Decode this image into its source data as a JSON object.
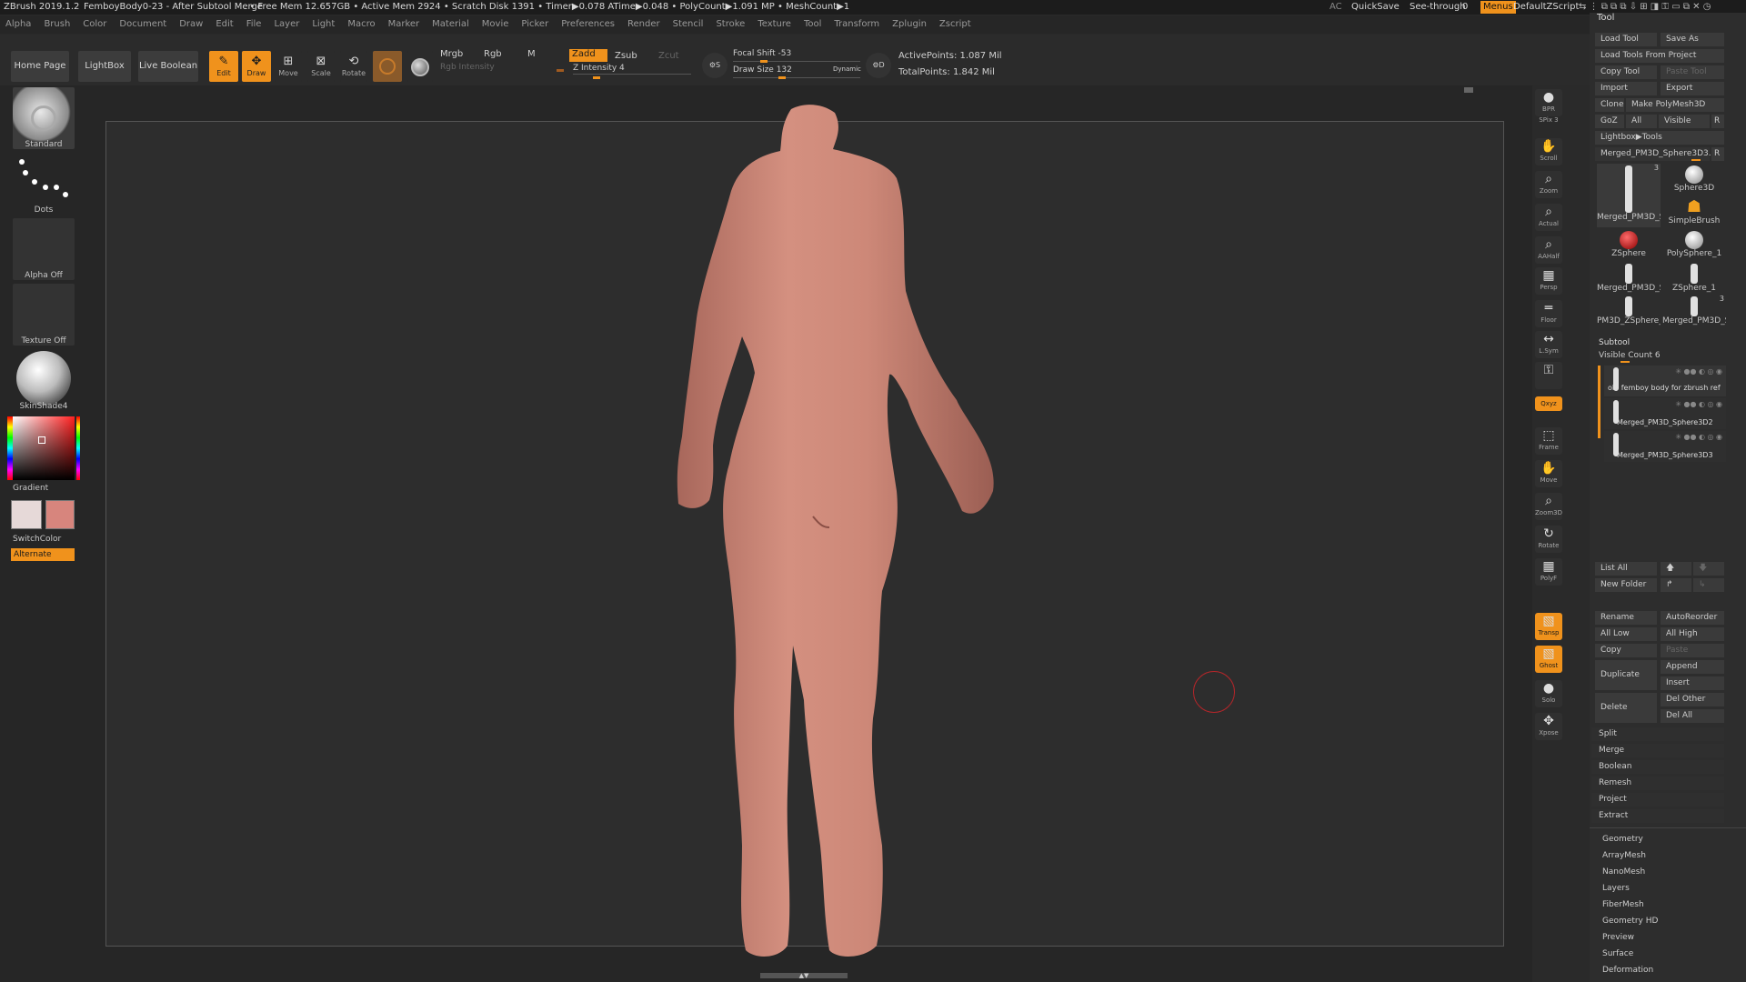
{
  "titlebar": {
    "app": "ZBrush 2019.1.2",
    "doc": "FemboyBody0-23 - After Subtool Merge",
    "stats": ". • Free Mem 12.657GB • Active Mem 2924 • Scratch Disk 1391 • Timer▶0.078 ATime▶0.048 • PolyCount▶1.091 MP • MeshCount▶1",
    "ac": "AC",
    "quicksave": "QuickSave",
    "seethrough": "See-through",
    "seethrough_value": "0",
    "menus": "Menus",
    "script": "DefaultZScript"
  },
  "menus": [
    "Alpha",
    "Brush",
    "Color",
    "Document",
    "Draw",
    "Edit",
    "File",
    "Layer",
    "Light",
    "Macro",
    "Marker",
    "Material",
    "Movie",
    "Picker",
    "Preferences",
    "Render",
    "Stencil",
    "Stroke",
    "Texture",
    "Tool",
    "Transform",
    "Zplugin",
    "Zscript"
  ],
  "shelf": {
    "home": "Home Page",
    "lightbox": "LightBox",
    "liveboolean": "Live Boolean",
    "edit": "Edit",
    "draw": "Draw",
    "move": "Move",
    "scale": "Scale",
    "rotate": "Rotate",
    "mrgb": "Mrgb",
    "rgb": "Rgb",
    "m": "M",
    "rgb_intensity": "Rgb Intensity",
    "zadd": "Zadd",
    "zsub": "Zsub",
    "zcut": "Zcut",
    "z_intensity": "Z Intensity 4",
    "focal_shift": "Focal Shift -53",
    "draw_size": "Draw Size 132",
    "dynamic": "Dynamic",
    "active_points": "ActivePoints: 1.087 Mil",
    "total_points": "TotalPoints: 1.842 Mil"
  },
  "left": {
    "brush": "Standard",
    "stroke": "Dots",
    "alpha": "Alpha Off",
    "texture": "Texture Off",
    "material": "SkinShade4",
    "gradient": "Gradient",
    "switchcolor": "SwitchColor",
    "alternate": "Alternate"
  },
  "right_shelf": [
    {
      "label": "BPR",
      "glyph": "●"
    },
    {
      "label": "SPix 3",
      "glyph": ""
    },
    {
      "label": "Scroll",
      "glyph": "✋"
    },
    {
      "label": "Zoom",
      "glyph": "⌕"
    },
    {
      "label": "Actual",
      "glyph": "⌕"
    },
    {
      "label": "AAHalf",
      "glyph": "⌕"
    },
    {
      "label": "Persp",
      "glyph": "▦"
    },
    {
      "label": "Floor",
      "glyph": "═"
    },
    {
      "label": "L.Sym",
      "glyph": "↔"
    },
    {
      "label": "",
      "glyph": "⚿"
    },
    {
      "label": "Qxyz",
      "glyph": ""
    },
    {
      "label": "Frame",
      "glyph": "⬚"
    },
    {
      "label": "Move",
      "glyph": "✋"
    },
    {
      "label": "Zoom3D",
      "glyph": "⌕"
    },
    {
      "label": "Rotate",
      "glyph": "↻"
    },
    {
      "label": "PolyF",
      "glyph": "▦"
    },
    {
      "label": "Transp",
      "glyph": "▧"
    },
    {
      "label": "Ghost",
      "glyph": "▧"
    },
    {
      "label": "Solo",
      "glyph": "●"
    },
    {
      "label": "Xpose",
      "glyph": "✥"
    }
  ],
  "tool": {
    "title": "Tool",
    "load_tool": "Load Tool",
    "save_as": "Save As",
    "load_from_project": "Load Tools From Project",
    "copy_tool": "Copy Tool",
    "paste_tool": "Paste Tool",
    "import": "Import",
    "export": "Export",
    "clone": "Clone",
    "make_polymesh": "Make PolyMesh3D",
    "goz": "GoZ",
    "all": "All",
    "visible": "Visible",
    "r": "R",
    "lightbox_tools": "Lightbox▶Tools",
    "current_tool": "Merged_PM3D_Sphere3D3.",
    "slots": [
      {
        "name": "Merged_PM3D_S",
        "badge": "3"
      },
      {
        "name": "Sphere3D",
        "badge": ""
      },
      {
        "name": "SimpleBrush",
        "badge": ""
      },
      {
        "name": "ZSphere",
        "badge": ""
      },
      {
        "name": "PolySphere_1",
        "badge": ""
      },
      {
        "name": "Merged_PM3D_S",
        "badge": ""
      },
      {
        "name": "ZSphere_1",
        "badge": ""
      },
      {
        "name": "PM3D_ZSphere_",
        "badge": ""
      },
      {
        "name": "Merged_PM3D_S",
        "badge": "3"
      }
    ],
    "subtool": "Subtool",
    "visible_count": "Visible Count 6",
    "subtools": [
      "old femboy body for zbrush ref",
      "Merged_PM3D_Sphere3D2",
      "Merged_PM3D_Sphere3D3"
    ],
    "list_all": "List All",
    "new_folder": "New Folder",
    "rename": "Rename",
    "autoreorder": "AutoReorder",
    "all_low": "All Low",
    "all_high": "All High",
    "copy": "Copy",
    "paste": "Paste",
    "duplicate": "Duplicate",
    "append": "Append",
    "insert": "Insert",
    "delete": "Delete",
    "del_other": "Del Other",
    "del_all": "Del All",
    "sections": [
      "Split",
      "Merge",
      "Boolean",
      "Remesh",
      "Project",
      "Extract"
    ],
    "subpalettes": [
      "Geometry",
      "ArrayMesh",
      "NanoMesh",
      "Layers",
      "FiberMesh",
      "Geometry HD",
      "Preview",
      "Surface",
      "Deformation"
    ]
  },
  "colors": {
    "accent": "#f0921c",
    "skin": "#c98677",
    "bg": "#2d2d2d"
  }
}
